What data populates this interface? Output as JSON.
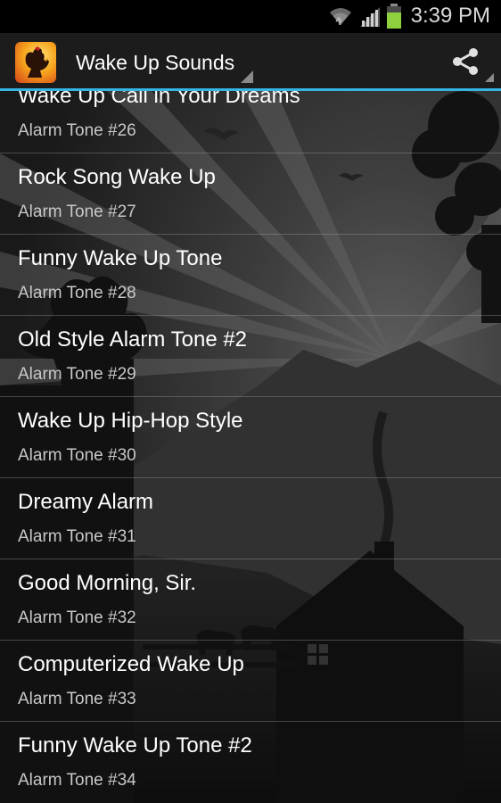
{
  "status_bar": {
    "time": "3:39 PM",
    "icons": [
      "wifi-icon",
      "signal-icon",
      "battery-icon"
    ],
    "battery_color": "#8fd13f"
  },
  "action_bar": {
    "title": "Wake Up Sounds",
    "accent_color": "#33b5e5",
    "app_icon": "rooster-icon",
    "share_icon": "share-icon"
  },
  "tones": [
    {
      "title": "Wake Up Call in Your Dreams",
      "subtitle": "Alarm Tone #26"
    },
    {
      "title": "Rock Song Wake Up",
      "subtitle": "Alarm Tone #27"
    },
    {
      "title": "Funny Wake Up Tone",
      "subtitle": "Alarm Tone #28"
    },
    {
      "title": "Old Style Alarm Tone #2",
      "subtitle": "Alarm Tone #29"
    },
    {
      "title": "Wake Up Hip-Hop Style",
      "subtitle": "Alarm Tone #30"
    },
    {
      "title": "Dreamy Alarm",
      "subtitle": "Alarm Tone #31"
    },
    {
      "title": "Good Morning, Sir.",
      "subtitle": "Alarm Tone #32"
    },
    {
      "title": "Computerized Wake Up",
      "subtitle": "Alarm Tone #33"
    },
    {
      "title": "Funny Wake Up Tone #2",
      "subtitle": "Alarm Tone #34"
    }
  ]
}
